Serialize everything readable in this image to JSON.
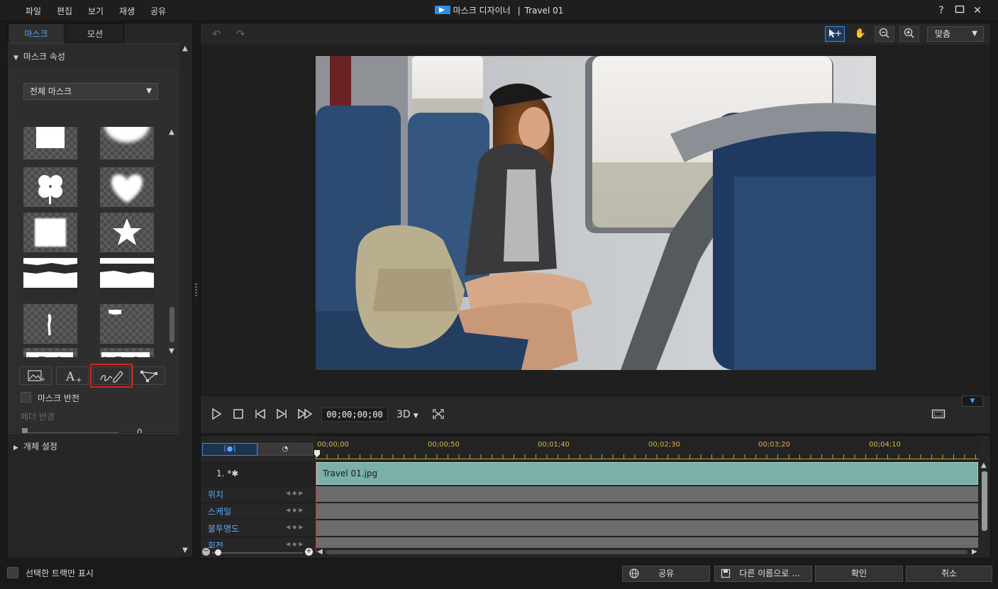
{
  "menu": [
    "파일",
    "편집",
    "보기",
    "재생",
    "공유"
  ],
  "window": {
    "title": "마스크 디자이너",
    "separator": "|",
    "project": "Travel 01",
    "help": "?",
    "maximize": "☐",
    "close": "✕"
  },
  "left_panel": {
    "tabs": [
      "마스크",
      "모션"
    ],
    "mask_section_title": "마스크 속성",
    "mask_dropdown_value": "전체 마스크",
    "mask_tools": [
      "image-mask-icon",
      "text-mask-icon",
      "freehand-mask-icon",
      "polygon-mask-icon"
    ],
    "invert_label": "마스크 반전",
    "feather_label": "페더 반경",
    "feather_value": "0",
    "object_section_title": "개체 설정"
  },
  "track_only_label": "선택한 트랙만 표시",
  "preview": {
    "fit_label": "맞춤",
    "timecode": "00;00;00;00",
    "mode_3d": "3D"
  },
  "timeline": {
    "ruler_labels": [
      "00;00;00",
      "00;00;50",
      "00;01;40",
      "00;02;30",
      "00;03;20",
      "00;04;10"
    ],
    "track_name": "1. *",
    "clip_name": "Travel 01.jpg",
    "keyframe_rows": [
      "위치",
      "스케일",
      "불투명도",
      "회전"
    ]
  },
  "footer": {
    "share": "공유",
    "save_as": "다른 이름으로 ...",
    "ok": "확인",
    "cancel": "취소"
  },
  "colors": {
    "accent": "#56a7f2",
    "highlight": "#e0201e",
    "clip": "#7ab0a5",
    "ruler": "#c9a33a",
    "playhead": "#d23030"
  }
}
